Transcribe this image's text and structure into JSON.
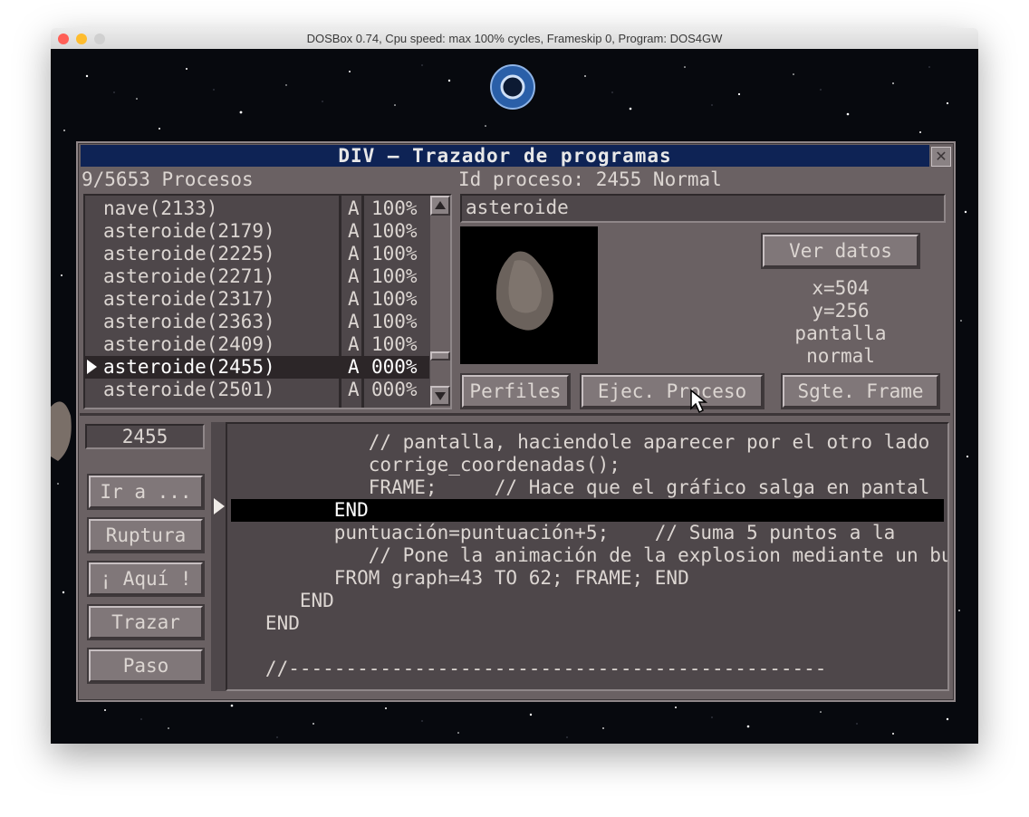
{
  "mac_window": {
    "title": "DOSBox 0.74, Cpu speed: max 100% cycles, Frameskip  0, Program:   DOS4GW",
    "colors": {
      "close": "#ff5f57",
      "minimize": "#febc2e",
      "zoom": "#d0d0d0"
    }
  },
  "div_window": {
    "title": "DIV — Trazador de programas",
    "close_icon": "close-icon",
    "process_count": "9/5653 Procesos",
    "process_id_label": "Id proceso: 2455 Normal",
    "process_name": "asteroide",
    "processes": [
      {
        "name": "nave(2133)",
        "state": "A",
        "percent": "100%",
        "selected": false
      },
      {
        "name": "asteroide(2179)",
        "state": "A",
        "percent": "100%",
        "selected": false
      },
      {
        "name": "asteroide(2225)",
        "state": "A",
        "percent": "100%",
        "selected": false
      },
      {
        "name": "asteroide(2271)",
        "state": "A",
        "percent": "100%",
        "selected": false
      },
      {
        "name": "asteroide(2317)",
        "state": "A",
        "percent": "100%",
        "selected": false
      },
      {
        "name": "asteroide(2363)",
        "state": "A",
        "percent": "100%",
        "selected": false
      },
      {
        "name": "asteroide(2409)",
        "state": "A",
        "percent": "100%",
        "selected": false
      },
      {
        "name": "asteroide(2455)",
        "state": "A",
        "percent": "000%",
        "selected": true
      },
      {
        "name": "asteroide(2501)",
        "state": "A",
        "percent": "000%",
        "selected": false
      }
    ],
    "ver_datos": "Ver datos",
    "coords": {
      "x": "x=504",
      "y": "y=256",
      "region": "pantalla",
      "mode": "normal"
    },
    "buttons": {
      "perfiles": "Perfiles",
      "ejec_proceso": "Ejec. Proceso",
      "sgte_frame": "Sgte. Frame"
    },
    "current_id": "2455",
    "side_buttons": {
      "ir_a": "Ir a ...",
      "ruptura": "Ruptura",
      "aqui": "¡ Aquí !",
      "trazar": "Trazar",
      "paso": "Paso"
    },
    "code_lines": [
      "            // pantalla, haciendole aparecer por el otro lado",
      "            corrige_coordenadas();",
      "            FRAME;     // Hace que el gráfico salga en pantal",
      "         END",
      "         puntuación=puntuación+5;    // Suma 5 puntos a la",
      "            // Pone la animación de la explosion mediante un buc",
      "         FROM graph=43 TO 62; FRAME; END",
      "      END",
      "   END",
      "",
      "   //-----------------------------------------------"
    ],
    "current_code_line": 3
  }
}
